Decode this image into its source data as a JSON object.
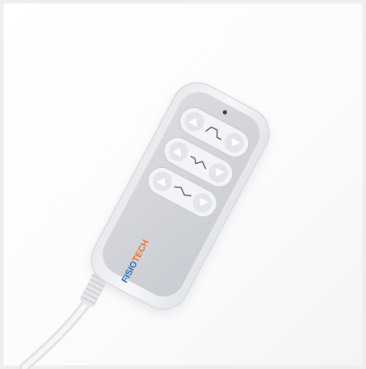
{
  "product": {
    "brand_part_1": "FI",
    "brand_part_2": "SIO",
    "brand_part_3": "TECH",
    "colors": {
      "background": "#ffffff",
      "border": "#eeeeee",
      "housing_shadow": "#e7e8ec",
      "housing_rim": "#f1f2f4",
      "face_panel": "#d3d5da",
      "button_ring": "#f4f5f7",
      "arrow": "#e2e4e8",
      "brand_blue": "#2e6fb5",
      "brand_orange": "#e8742a"
    },
    "buttons": [
      {
        "row": "top",
        "icon": "backrest-icon"
      },
      {
        "row": "middle",
        "icon": "legrest-icon"
      },
      {
        "row": "bottom",
        "icon": "bed-height-icon"
      }
    ]
  }
}
